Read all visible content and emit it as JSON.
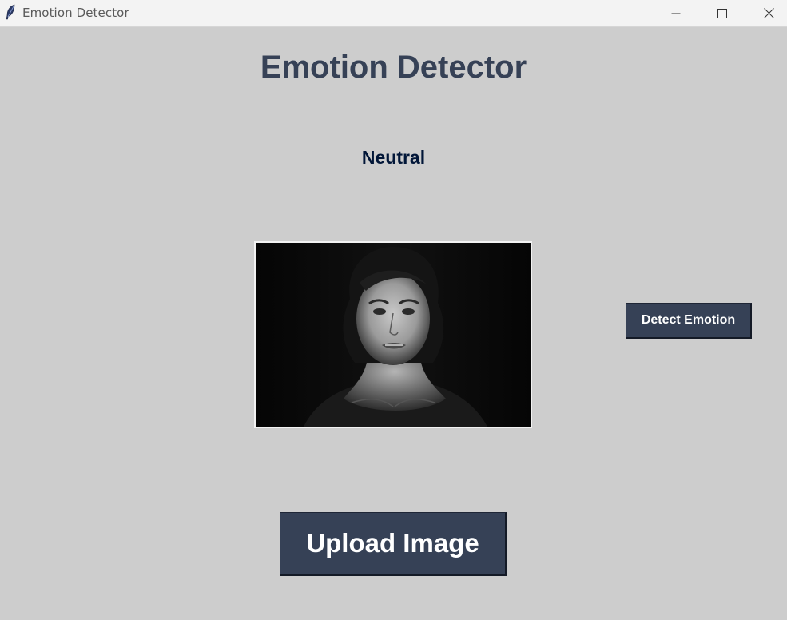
{
  "window": {
    "title": "Emotion Detector",
    "controls": {
      "minimize": "minimize-icon",
      "maximize": "maximize-icon",
      "close": "close-icon"
    }
  },
  "app": {
    "heading": "Emotion Detector",
    "result": "Neutral",
    "image_alt": "Grayscale portrait of a woman with a distressed expression",
    "buttons": {
      "detect": "Detect Emotion",
      "upload": "Upload Image"
    }
  },
  "colors": {
    "background": "#cdcdcd",
    "heading": "#364156",
    "result": "#011638",
    "button_bg": "#364156",
    "button_text": "#ffffff"
  }
}
